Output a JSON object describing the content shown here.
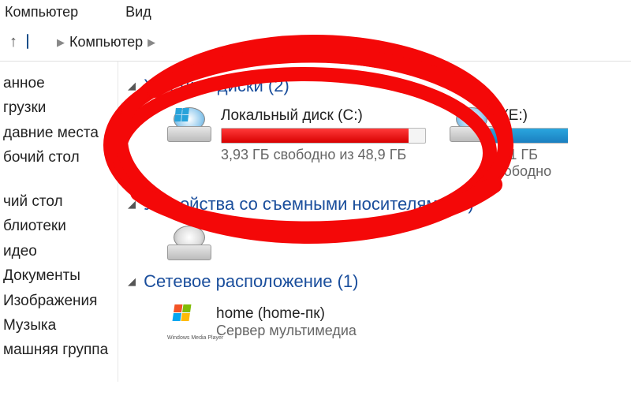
{
  "menubar": {
    "computer": "Компьютер",
    "view": "Вид"
  },
  "breadcrumb": {
    "root": "Компьютер"
  },
  "sidebar": {
    "group1": [
      "анное",
      "грузки",
      "давние места",
      "бочий стол"
    ],
    "group2": [
      "чий стол",
      "блиотеки",
      "идео",
      "Документы",
      "Изображения",
      "Музыка",
      "машняя группа"
    ]
  },
  "sections": {
    "hdd": {
      "label": "Жесткие диски",
      "count": "(2)"
    },
    "removable": {
      "label": "Устройства со съемными носителями",
      "count": "(1)"
    },
    "network": {
      "label": "Сетевое расположение",
      "count": "(1)"
    }
  },
  "drives": {
    "c": {
      "name": "Локальный диск (C:)",
      "free_text": "3,93 ГБ свободно из 48,9 ГБ",
      "fill_percent": 92
    },
    "e": {
      "name": "E (E:)",
      "free_text": "41,1 ГБ свободно",
      "fill_percent": 100
    }
  },
  "network": {
    "item": {
      "name": "home (home-пк)",
      "sub": "Сервер мультимедиа",
      "icon_text": "Windows Media Player"
    }
  }
}
